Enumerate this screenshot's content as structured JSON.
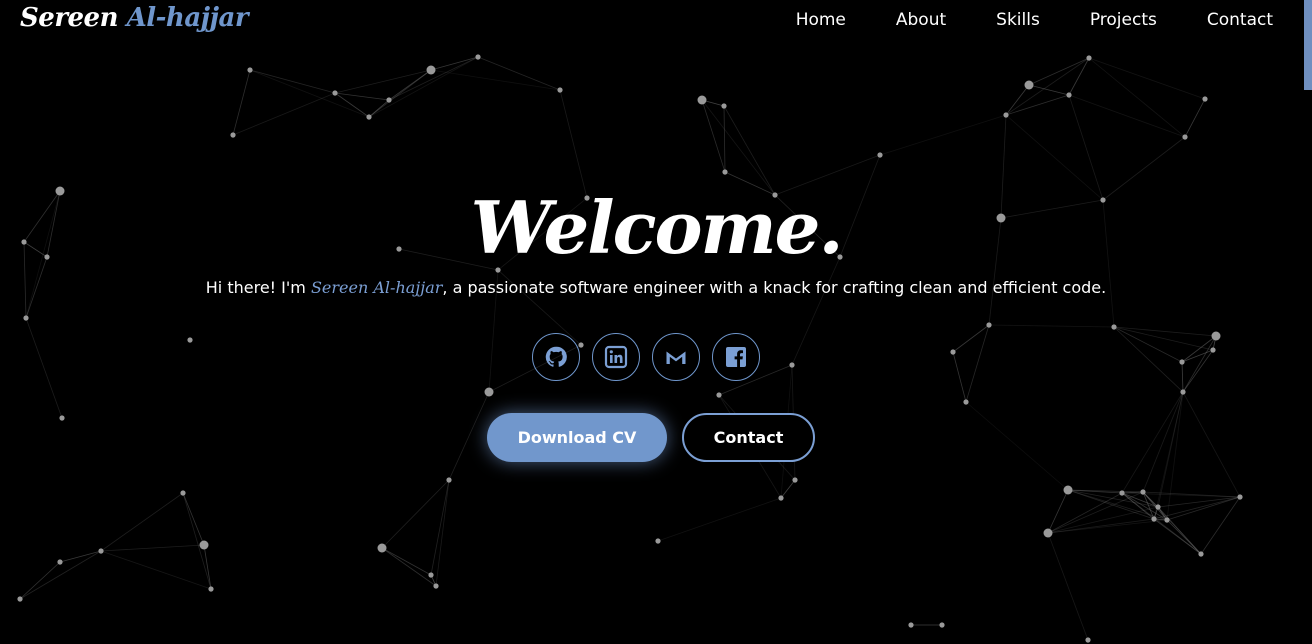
{
  "header": {
    "logo_first": "Sereen",
    "logo_last": "Al-hajjar"
  },
  "nav": {
    "items": [
      "Home",
      "About",
      "Skills",
      "Projects",
      "Contact"
    ]
  },
  "hero": {
    "title": "Welcome.",
    "intro_before": "Hi there! I'm ",
    "intro_name": "Sereen Al-hajjar",
    "intro_after": ", a passionate software engineer with a knack for crafting clean and efficient code.",
    "socials": [
      "github-icon",
      "linkedin-icon",
      "gmail-icon",
      "facebook-icon"
    ],
    "download_label": "Download CV",
    "contact_label": "Contact"
  },
  "colors": {
    "accent": "#7197cc",
    "background": "#000000"
  }
}
